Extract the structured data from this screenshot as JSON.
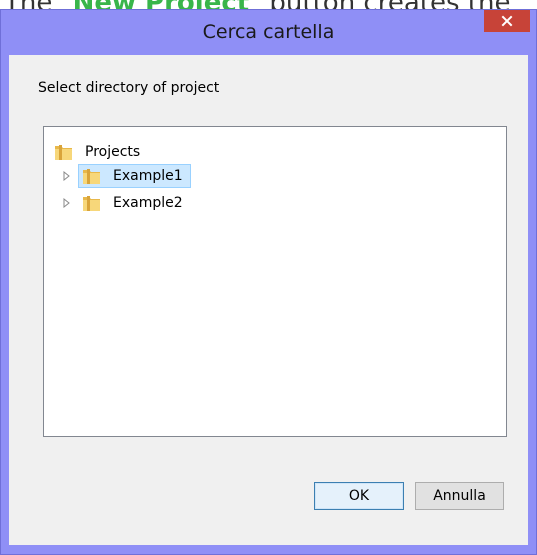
{
  "background": {
    "caption_prefix": "The \"",
    "caption_highlight": "New Project",
    "caption_suffix": "\" button creates the"
  },
  "dialog": {
    "title": "Cerca cartella",
    "prompt": "Select directory of project",
    "tree": {
      "root": "Projects",
      "children": [
        {
          "label": "Example1",
          "selected": true
        },
        {
          "label": "Example2",
          "selected": false
        }
      ]
    },
    "buttons": {
      "ok": "OK",
      "cancel": "Annulla"
    }
  },
  "colors": {
    "frame": "#8f8ff6",
    "close": "#c74338",
    "selection": "#cce8ff",
    "highlight_text": "#39b54a"
  }
}
